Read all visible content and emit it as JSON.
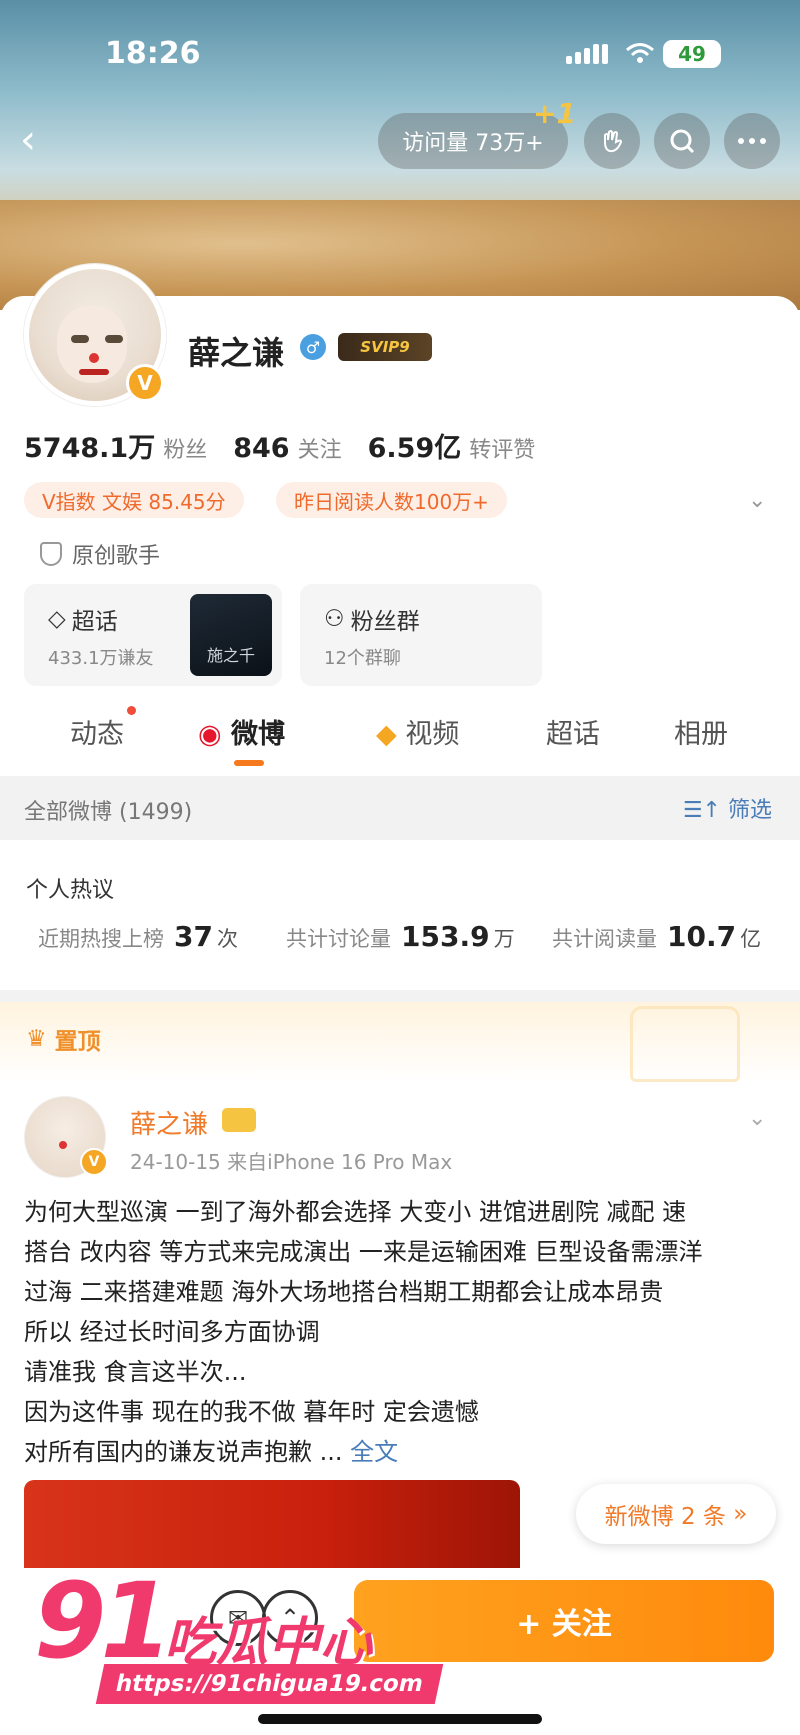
{
  "status": {
    "time": "18:26",
    "battery": "49"
  },
  "topbar": {
    "visits": "访问量 73万+",
    "visits_plus": "+1"
  },
  "profile": {
    "name": "薛之谦",
    "gender_symbol": "♂",
    "vip_badge": "SVIP9",
    "verified_badge": "V",
    "stats": [
      {
        "value": "5748.1万",
        "label": "粉丝"
      },
      {
        "value": "846",
        "label": "关注"
      },
      {
        "value": "6.59亿",
        "label": "转评赞"
      }
    ],
    "tags": [
      "V指数 文娱 85.45分",
      "昨日阅读人数100万+"
    ],
    "certification": "原创歌手"
  },
  "boxes": {
    "topic": {
      "title": "超话",
      "sub": "433.1万谦友",
      "thumb_text": "施之千"
    },
    "fan_group": {
      "title": "粉丝群",
      "sub": "12个群聊"
    }
  },
  "tabs": [
    "动态",
    "微博",
    "视频",
    "超话",
    "相册"
  ],
  "filter": {
    "left": "全部微博 (1499)",
    "right": "筛选"
  },
  "hot": {
    "heading": "个人热议",
    "items": [
      {
        "label": "近期热搜上榜",
        "value": "37",
        "unit": "次"
      },
      {
        "label": "共计讨论量",
        "value": "153.9",
        "unit": "万"
      },
      {
        "label": "共计阅读量",
        "value": "10.7",
        "unit": "亿"
      }
    ]
  },
  "pinned_label": "置顶",
  "post": {
    "author": "薛之谦",
    "meta": "24-10-15  来自iPhone 16 Pro Max",
    "lines": [
      "为何大型巡演 一到了海外都会选择 大变小 进馆进剧院 减配 速",
      "搭台 改内容 等方式来完成演出 一来是运输困难 巨型设备需漂洋",
      "过海 二来搭建难题 海外大场地搭台档期工期都会让成本昂贵",
      "所以 经过长时间多方面协调",
      "请准我 食言这半次...",
      "因为这件事 现在的我不做 暮年时 定会遗憾",
      "对所有国内的谦友说声抱歉 ..."
    ],
    "more_link": "全文"
  },
  "new_posts": "新微博 2 条",
  "follow_button": "+ 关注",
  "watermark": {
    "number": "91",
    "brand": "吃瓜中心",
    "url": "https://91chigua19.com"
  },
  "colors": {
    "accent": "#f7791e",
    "link": "#4a7db8",
    "watermark": "#f03a6e"
  }
}
